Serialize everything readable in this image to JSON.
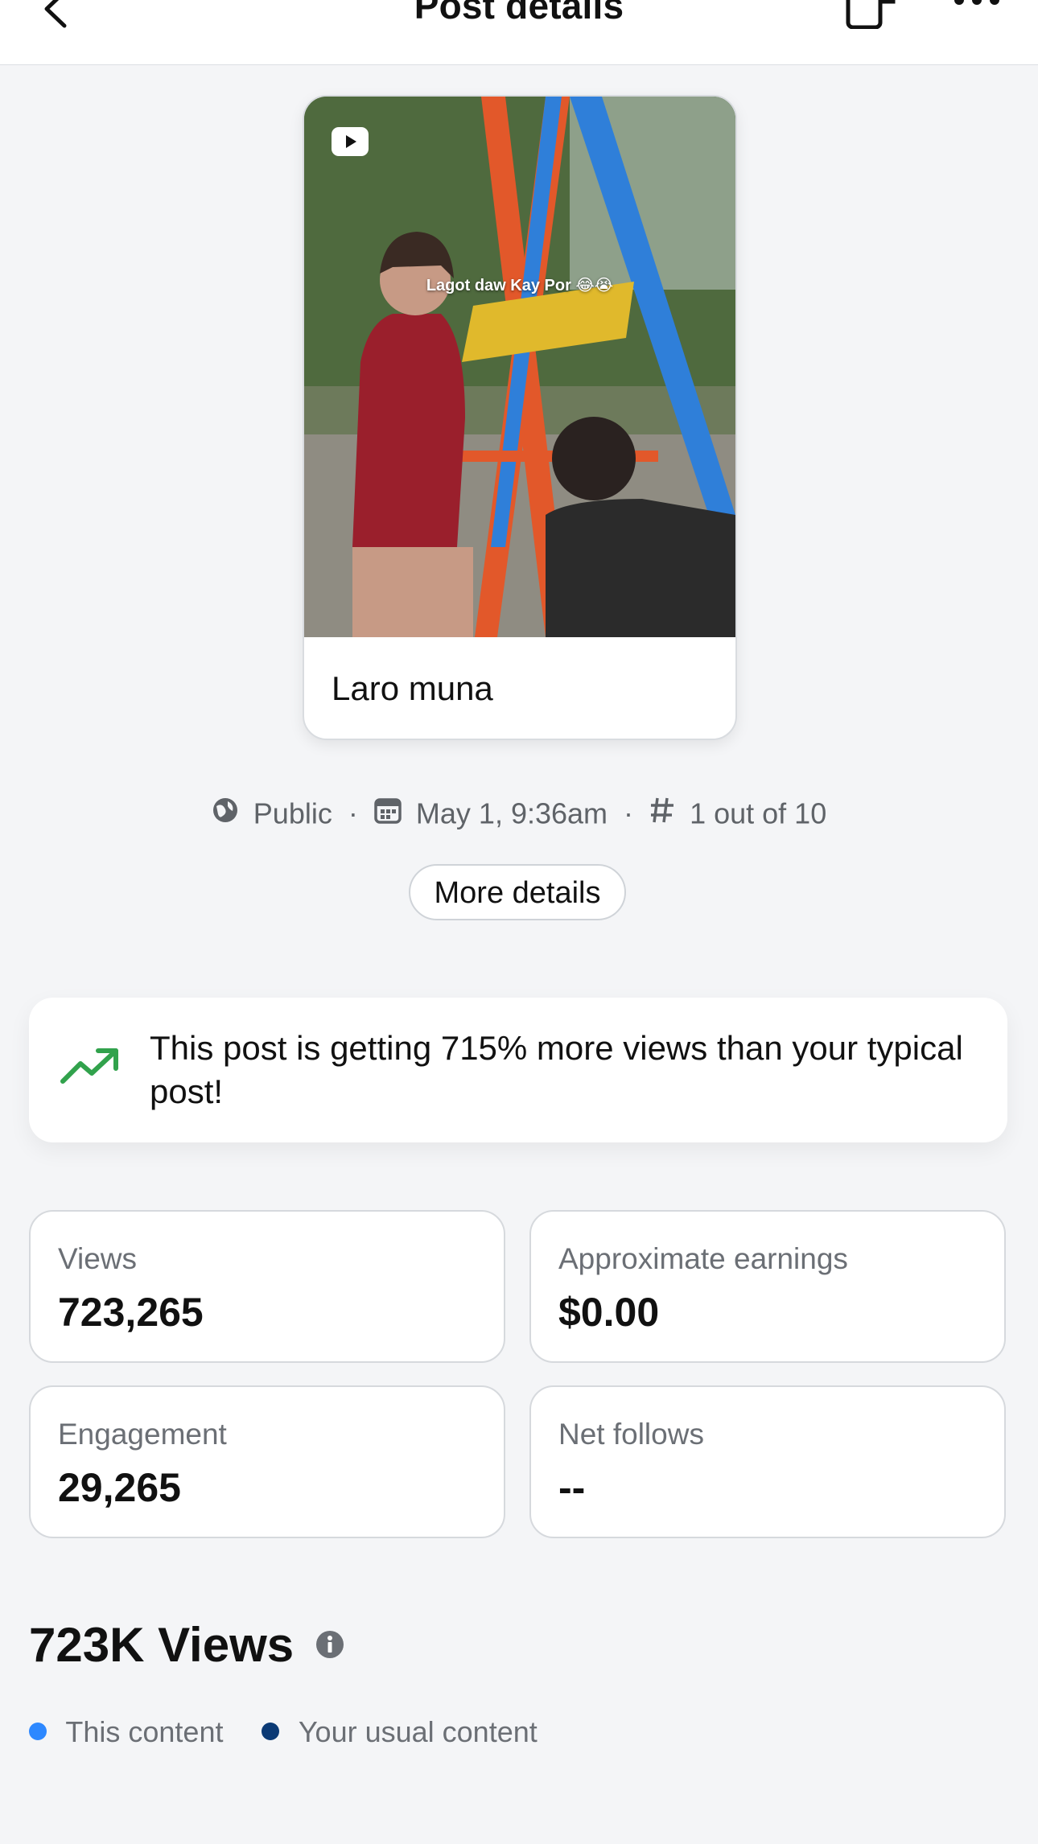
{
  "header": {
    "title": "Post details"
  },
  "post": {
    "overlay_text": "Lagot daw Kay Por 😂😭",
    "caption": "Laro muna"
  },
  "meta": {
    "visibility": "Public",
    "date": "May 1, 9:36am",
    "rank": "1 out of 10"
  },
  "buttons": {
    "more_details": "More details"
  },
  "insight": {
    "text": "This post is getting 715% more views than your typical post!"
  },
  "stats": {
    "views_label": "Views",
    "views_value": "723,265",
    "earnings_label": "Approximate earnings",
    "earnings_value": "$0.00",
    "engagement_label": "Engagement",
    "engagement_value": "29,265",
    "follows_label": "Net follows",
    "follows_value": "--"
  },
  "views_section": {
    "title": "723K Views",
    "legend_this": "This content",
    "legend_usual": "Your usual content"
  },
  "colors": {
    "accent_light_blue": "#2d88ff",
    "accent_dark_blue": "#0b3a75",
    "trend_green": "#31a24c"
  }
}
